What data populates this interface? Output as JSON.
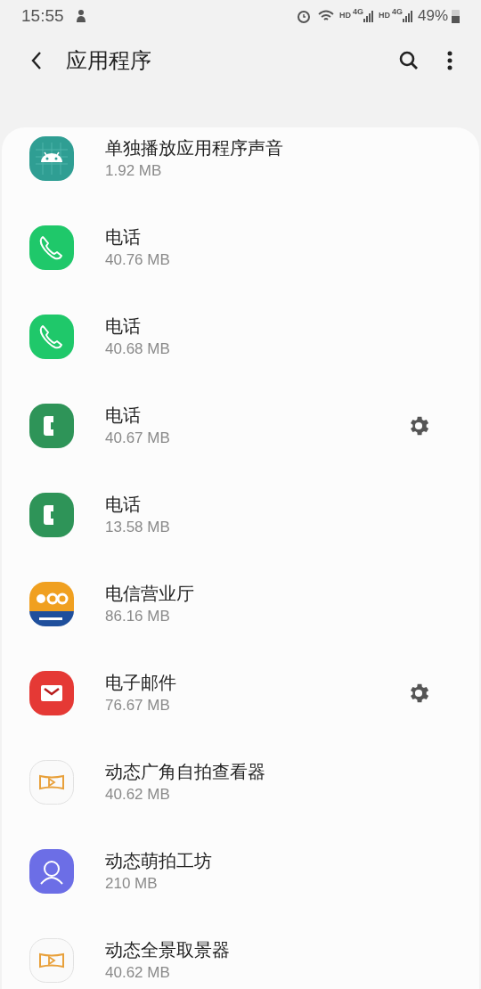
{
  "status_bar": {
    "time": "15:55",
    "network_labels": [
      "HD",
      "4G",
      "HD",
      "4G"
    ],
    "battery": "49%"
  },
  "header": {
    "title": "应用程序"
  },
  "apps": [
    {
      "kind": "android",
      "name": "单独播放应用程序声音",
      "size": "1.92 MB",
      "settings": false
    },
    {
      "kind": "phone-outline",
      "name": "电话",
      "size": "40.76 MB",
      "settings": false
    },
    {
      "kind": "phone-outline",
      "name": "电话",
      "size": "40.68 MB",
      "settings": false
    },
    {
      "kind": "phone-solid",
      "name": "电话",
      "size": "40.67 MB",
      "settings": true
    },
    {
      "kind": "phone-solid",
      "name": "电话",
      "size": "13.58 MB",
      "settings": false
    },
    {
      "kind": "telecom",
      "name": "电信营业厅",
      "size": "86.16 MB",
      "settings": false
    },
    {
      "kind": "mail",
      "name": "电子邮件",
      "size": "76.67 MB",
      "settings": true
    },
    {
      "kind": "panorama",
      "name": "动态广角自拍查看器",
      "size": "40.62 MB",
      "settings": false
    },
    {
      "kind": "avatar",
      "name": "动态萌拍工坊",
      "size": "210 MB",
      "settings": false
    },
    {
      "kind": "panorama",
      "name": "动态全景取景器",
      "size": "40.62 MB",
      "settings": false
    }
  ]
}
